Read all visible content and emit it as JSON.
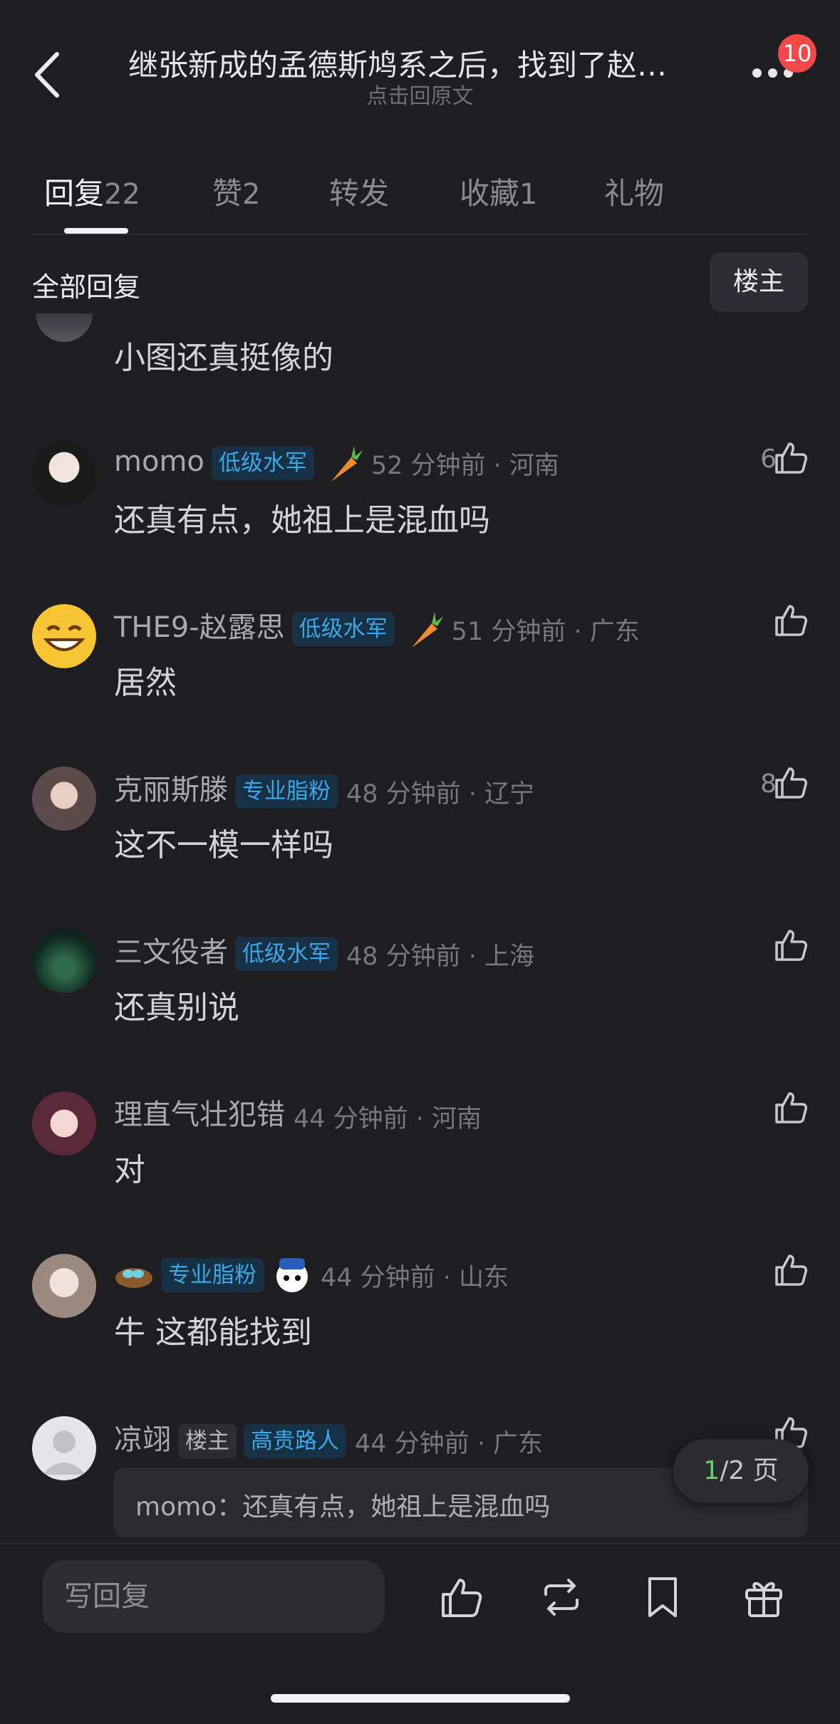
{
  "header": {
    "title": "继张新成的孟德斯鸠系之后，找到了赵…",
    "subtitle": "点击回原文",
    "notification_count": "10"
  },
  "tabs": [
    {
      "label": "回复",
      "count": "22"
    },
    {
      "label": "赞",
      "count": "2"
    },
    {
      "label": "转发",
      "count": ""
    },
    {
      "label": "收藏",
      "count": "1"
    },
    {
      "label": "礼物",
      "count": ""
    }
  ],
  "section": {
    "title": "全部回复",
    "filter_label": "楼主"
  },
  "partial_comment": {
    "text": "小图还真挺像的"
  },
  "comments": [
    {
      "user": "momo",
      "tag": "低级水军",
      "meta": "52 分钟前 · 河南",
      "text": "还真有点，她祖上是混血吗",
      "likes": "6"
    },
    {
      "user": "THE9-赵露思",
      "tag": "低级水军",
      "meta": "51 分钟前 · 广东",
      "text": "居然",
      "likes": ""
    },
    {
      "user": "克丽斯滕",
      "tag": "专业脂粉",
      "meta": "48 分钟前 · 辽宁",
      "text": "这不一模一样吗",
      "likes": "8"
    },
    {
      "user": "三文役者",
      "tag": "低级水军",
      "meta": "48 分钟前 · 上海",
      "text": "还真别说",
      "likes": ""
    },
    {
      "user": "理直气壮犯错",
      "tag": "",
      "meta": "44 分钟前 · 河南",
      "text": "对",
      "likes": ""
    },
    {
      "user": "",
      "tag": "专业脂粉",
      "meta": "44 分钟前 · 山东",
      "text": "牛  这都能找到",
      "likes": ""
    },
    {
      "user": "凉翊",
      "owner_tag": "楼主",
      "tag": "高贵路人",
      "meta": "44 分钟前 · 广东",
      "text": "",
      "likes": ""
    }
  ],
  "quote": {
    "text": "momo：还真有点，她祖上是混血吗"
  },
  "pager": {
    "current": "1",
    "rest": "/2 页"
  },
  "bottom": {
    "reply_placeholder": "写回复"
  },
  "icons": {
    "back": "chevron-left-icon",
    "more": "more-dots-icon",
    "like": "thumbs-up-icon",
    "repost": "repost-icon",
    "bookmark": "bookmark-icon",
    "gift": "gift-icon"
  }
}
